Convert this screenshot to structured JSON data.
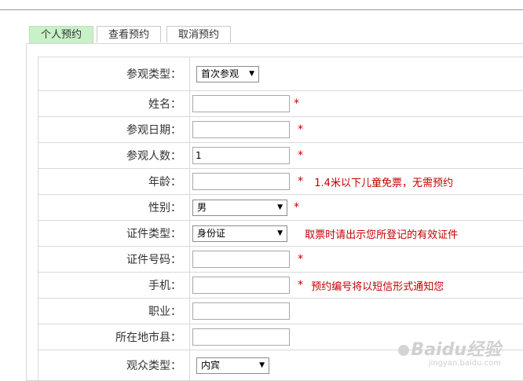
{
  "tabs": [
    {
      "label": "个人预约",
      "active": true
    },
    {
      "label": "查看预约",
      "active": false
    },
    {
      "label": "取消预约",
      "active": false
    }
  ],
  "form": {
    "visit_type": {
      "label": "参观类型：",
      "selected": "首次参观"
    },
    "name": {
      "label": "姓名：",
      "value": ""
    },
    "visit_date": {
      "label": "参观日期：",
      "value": ""
    },
    "visitor_count": {
      "label": "参观人数：",
      "value": "1"
    },
    "age": {
      "label": "年龄：",
      "value": "",
      "note": "1.4米以下儿童免票，无需预约"
    },
    "gender": {
      "label": "性别：",
      "selected": "男"
    },
    "id_type": {
      "label": "证件类型：",
      "selected": "身份证",
      "note": "取票时请出示您所登记的有效证件"
    },
    "id_number": {
      "label": "证件号码：",
      "value": ""
    },
    "phone": {
      "label": "手机：",
      "value": "",
      "note": "预约编号将以短信形式通知您"
    },
    "occupation": {
      "label": "职业：",
      "value": ""
    },
    "city": {
      "label": "所在地市县：",
      "value": ""
    },
    "audience_type": {
      "label": "观众类型：",
      "selected": "内宾"
    }
  },
  "required_mark": "*",
  "watermark": {
    "logo": "Baidu经验",
    "site": "jingyan.baidu.com"
  },
  "colors": {
    "active_tab": "#c8f1c8",
    "required": "#c00000",
    "border": "#d9d9d9"
  }
}
